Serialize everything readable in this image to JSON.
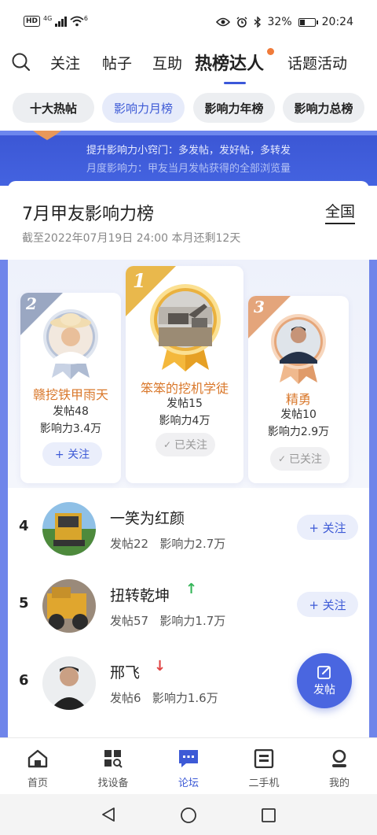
{
  "status_bar": {
    "network": "4G",
    "network2": "6",
    "hd": "HD",
    "battery": "32%",
    "battery_level": 0.32,
    "time": "20:24"
  },
  "top_nav": {
    "tabs": [
      "关注",
      "帖子",
      "互助",
      "热榜达人",
      "话题活动"
    ],
    "active_tab": "热榜达人"
  },
  "pills": [
    "十大热帖",
    "影响力月榜",
    "影响力年榜",
    "影响力总榜"
  ],
  "banner": {
    "line1": "提升影响力小窍门：多发帖，发好帖，多转发",
    "line2": "月度影响力：甲友当月发帖获得的全部浏览量"
  },
  "header": {
    "title": "7月甲友影响力榜",
    "region": "全国",
    "subtitle": "截至2022年07月19日 24:00 本月还剩12天"
  },
  "podium": [
    {
      "rank": "2",
      "name": "赣挖铁甲雨天",
      "posts": "发帖48",
      "influence": "影响力3.4万",
      "button": "+ 关注"
    },
    {
      "rank": "1",
      "name": "笨笨的挖机学徒",
      "posts": "发帖15",
      "influence": "影响力4万",
      "button": "已关注"
    },
    {
      "rank": "3",
      "name": "精勇",
      "posts": "发帖10",
      "influence": "影响力2.9万",
      "button": "已关注"
    }
  ],
  "list": [
    {
      "rank": "4",
      "name": "一笑为红颜",
      "posts": "发帖22",
      "influence": "影响力2.7万",
      "button": "+ 关注",
      "trend": ""
    },
    {
      "rank": "5",
      "name": "扭转乾坤",
      "posts": "发帖57",
      "influence": "影响力1.7万",
      "button": "+ 关注",
      "trend": "up"
    },
    {
      "rank": "6",
      "name": "邢飞",
      "posts": "发帖6",
      "influence": "影响力1.6万",
      "button": "",
      "trend": "down"
    }
  ],
  "fab": {
    "label": "发帖"
  },
  "bottom_tabs": [
    "首页",
    "找设备",
    "论坛",
    "二手机",
    "我的"
  ],
  "active_bottom_tab": "论坛",
  "colors": {
    "accent": "#3d5ad6",
    "orange_name": "#d9772a",
    "gold": "#e8b54a",
    "silver": "#aab6cc",
    "bronze": "#e0a070"
  }
}
